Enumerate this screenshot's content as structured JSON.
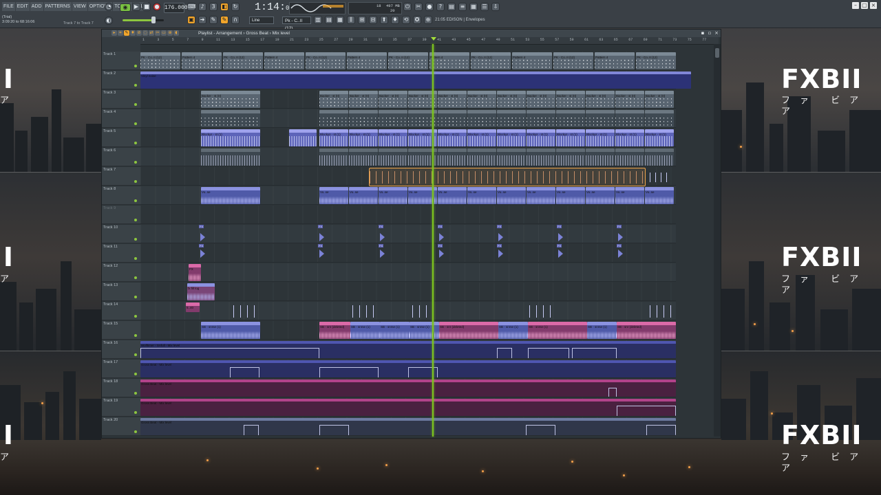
{
  "app": {
    "menu": [
      "FILE",
      "EDIT",
      "ADD",
      "PATTERNS",
      "VIEW",
      "OPTIONS",
      "TOOLS",
      "HELP"
    ],
    "info_line1": "(Trial)",
    "info_line2": "3:09:20 to 68:16:06",
    "hint": "Track 7 to Track 7",
    "tempo": "176.000",
    "song_position": "1:14:",
    "song_position_small": "01",
    "cpu_mem": "497 MB",
    "cpu_val": "18",
    "poly_val": "20",
    "snap": "Line",
    "pattern": "Pk - C..II (12)",
    "plugin_picker": "21:05  EDISON | Envelopes"
  },
  "playlist": {
    "title": "Playlist - Arrangement › Gross Beat › Mix level",
    "ruler": [
      "1",
      "3",
      "5",
      "7",
      "9",
      "11",
      "13",
      "15",
      "17",
      "19",
      "21",
      "23",
      "25",
      "27",
      "29",
      "31",
      "33",
      "35",
      "37",
      "39",
      "41",
      "43",
      "45",
      "47",
      "49",
      "51",
      "53",
      "55",
      "57",
      "59",
      "61",
      "63",
      "65",
      "67",
      "69",
      "71",
      "73",
      "75",
      "77"
    ],
    "tracks": [
      {
        "name": "Track 1"
      },
      {
        "name": "Track 2"
      },
      {
        "name": "Track 3"
      },
      {
        "name": "Track 4"
      },
      {
        "name": "Track 5"
      },
      {
        "name": "Track 6"
      },
      {
        "name": "Track 7"
      },
      {
        "name": "Track 8"
      },
      {
        "name": "Track 9"
      },
      {
        "name": "Track 10"
      },
      {
        "name": "Track 11"
      },
      {
        "name": "Track 12"
      },
      {
        "name": "Track 13"
      },
      {
        "name": "Track 14"
      },
      {
        "name": "Track 15"
      },
      {
        "name": "Track 16"
      },
      {
        "name": "Track 17"
      },
      {
        "name": "Track 18"
      },
      {
        "name": "Track 19"
      },
      {
        "name": "Track 20"
      }
    ],
    "clip_labels": {
      "pattern_pk": "PK - Co..II (12)",
      "pattern_4": "Pattern 4",
      "vinyl": "Vinyl noise",
      "hat": "Hat - Hat - kll",
      "backer": "Backer - st (II)",
      "shake": "Blockys - st (1)",
      "vox": "Vo..se",
      "fx12": "FX",
      "fxfill": "fx fill log",
      "slices": "5..40",
      "sb": "SB - snrse (1)",
      "sb_del": "SB - snr (deleted)",
      "wolf": "Wolftimer - SAfull - Mix level",
      "gross": "Gross Beat - Mix level"
    }
  },
  "branding": {
    "logo": "FXBII",
    "sub": "ファ ビアア"
  },
  "colors": {
    "accent_orange": "#f1a52b",
    "playhead_green": "#7dc41e",
    "clip_purple": "#8187d8",
    "clip_pink": "#db6aa8"
  }
}
